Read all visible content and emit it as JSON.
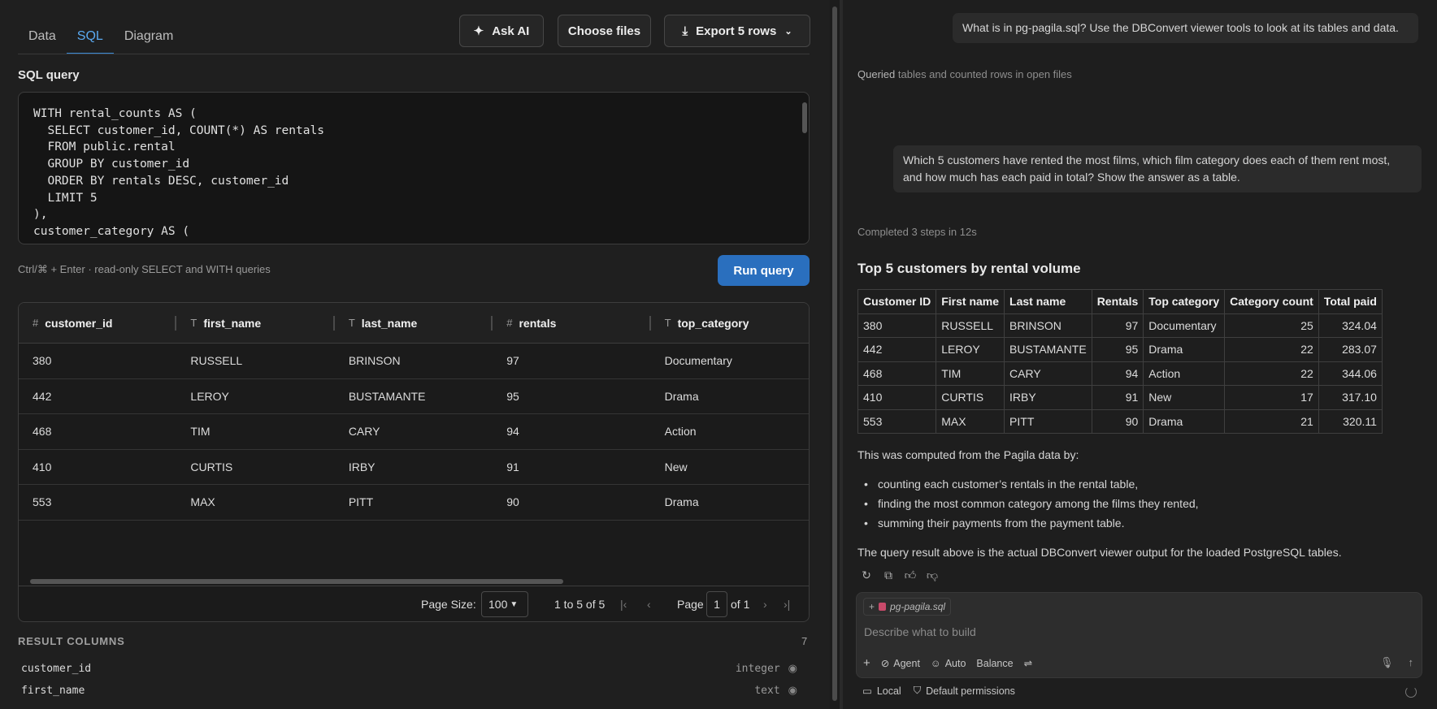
{
  "tabs": [
    "Data",
    "SQL",
    "Diagram"
  ],
  "toolbar": {
    "ask_ai": "Ask AI",
    "choose_files": "Choose files",
    "export": "Export 5 rows"
  },
  "editor": {
    "label": "SQL query",
    "code": "WITH rental_counts AS (\n  SELECT customer_id, COUNT(*) AS rentals\n  FROM public.rental\n  GROUP BY customer_id\n  ORDER BY rentals DESC, customer_id\n  LIMIT 5\n),\ncustomer_category AS (",
    "hint": "Ctrl/⌘ + Enter · read-only SELECT and WITH queries",
    "run_label": "Run query"
  },
  "grid": {
    "columns": [
      {
        "type_icon": "#",
        "name": "customer_id"
      },
      {
        "type_icon": "T",
        "name": "first_name"
      },
      {
        "type_icon": "T",
        "name": "last_name"
      },
      {
        "type_icon": "#",
        "name": "rentals"
      },
      {
        "type_icon": "T",
        "name": "top_category"
      }
    ],
    "rows": [
      [
        "380",
        "RUSSELL",
        "BRINSON",
        "97",
        "Documentary"
      ],
      [
        "442",
        "LEROY",
        "BUSTAMANTE",
        "95",
        "Drama"
      ],
      [
        "468",
        "TIM",
        "CARY",
        "94",
        "Action"
      ],
      [
        "410",
        "CURTIS",
        "IRBY",
        "91",
        "New"
      ],
      [
        "553",
        "MAX",
        "PITT",
        "90",
        "Drama"
      ]
    ],
    "pager": {
      "page_size_label": "Page Size:",
      "page_size": "100",
      "range": "1 to 5 of 5",
      "page_label": "Page",
      "page": "1",
      "of": "of 1"
    }
  },
  "result_columns": {
    "title": "RESULT COLUMNS",
    "count": "7",
    "items": [
      {
        "name": "customer_id",
        "type": "integer"
      },
      {
        "name": "first_name",
        "type": "text"
      }
    ]
  },
  "chat": {
    "q1": "What is in pg-pagila.sql? Use the DBConvert viewer tools to look at its tables and data.",
    "step1_strong": "Queried",
    "step1_rest": "tables and counted rows in open files",
    "q2": "Which 5 customers have rented the most films, which film category does each of them rent most, and how much has each paid in total? Show the answer as a table.",
    "completed": "Completed 3 steps in 12s",
    "answer_title": "Top 5 customers by rental volume",
    "table_headers": [
      "Customer ID",
      "First name",
      "Last name",
      "Rentals",
      "Top category",
      "Category count",
      "Total paid"
    ],
    "table_rows": [
      [
        "380",
        "RUSSELL",
        "BRINSON",
        "97",
        "Documentary",
        "25",
        "324.04"
      ],
      [
        "442",
        "LEROY",
        "BUSTAMANTE",
        "95",
        "Drama",
        "22",
        "283.07"
      ],
      [
        "468",
        "TIM",
        "CARY",
        "94",
        "Action",
        "22",
        "344.06"
      ],
      [
        "410",
        "CURTIS",
        "IRBY",
        "91",
        "New",
        "17",
        "317.10"
      ],
      [
        "553",
        "MAX",
        "PITT",
        "90",
        "Drama",
        "21",
        "320.11"
      ]
    ],
    "computed_intro": "This was computed from the Pagila data by:",
    "bullets": [
      "counting each customer’s rentals in the rental table,",
      "finding the most common category among the films they rented,",
      "summing their payments from the payment table."
    ],
    "closing": "The query result above is the actual DBConvert viewer output for the loaded PostgreSQL tables."
  },
  "composer": {
    "file_chip": "pg-pagila.sql",
    "placeholder": "Describe what to build",
    "agent": "Agent",
    "auto": "Auto",
    "balance": "Balance"
  },
  "statusbar": {
    "local": "Local",
    "permissions": "Default permissions"
  },
  "colors": {
    "accent": "#2a6fbe",
    "active_tab": "#5aa9f0"
  }
}
